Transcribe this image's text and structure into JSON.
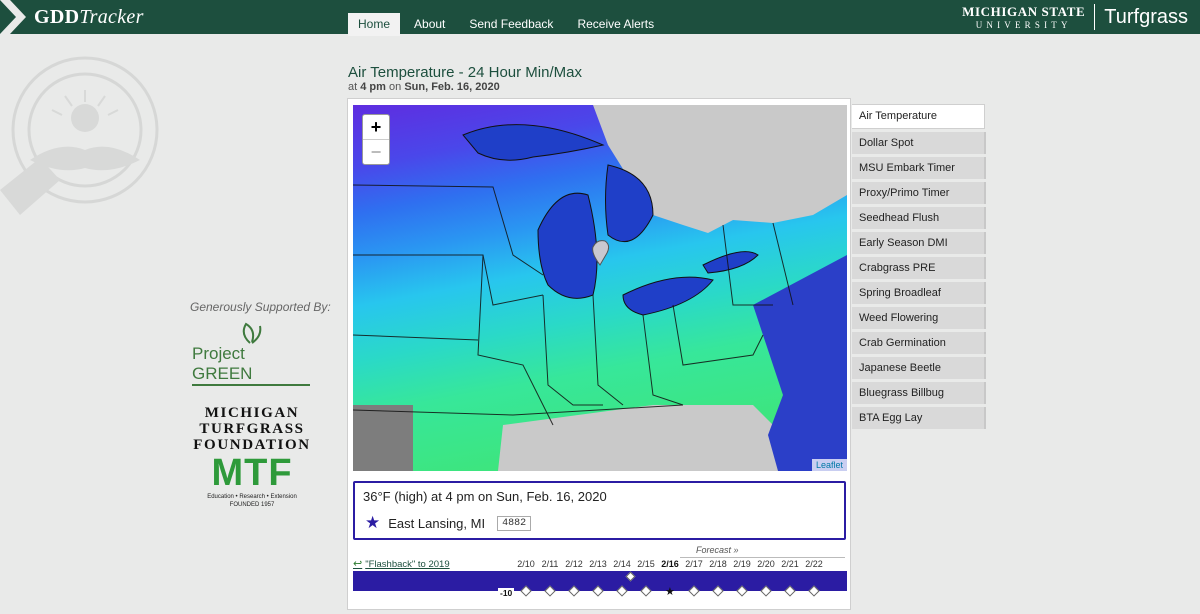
{
  "header": {
    "brand_bold": "GDD",
    "brand_italic": "Tracker",
    "nav": [
      {
        "label": "Home",
        "active": true
      },
      {
        "label": "About",
        "active": false
      },
      {
        "label": "Send Feedback",
        "active": false
      },
      {
        "label": "Receive Alerts",
        "active": false
      }
    ],
    "msu_line1": "MICHIGAN STATE",
    "msu_line2": "UNIVERSITY",
    "turfgrass": "Turfgrass"
  },
  "sidebar": {
    "supported_label": "Generously Supported By:",
    "sponsor1": "Project GREEN",
    "sponsor2": {
      "line1": "MICHIGAN",
      "line2": "TURFGRASS",
      "line3": "FOUNDATION",
      "abbr": "MTF",
      "tagline": "Education • Research • Extension",
      "founded": "FOUNDED 1957"
    }
  },
  "main": {
    "title": "Air Temperature - 24 Hour Min/Max",
    "subtitle_prefix": "at",
    "subtitle_time": "4 pm",
    "subtitle_on": "on",
    "subtitle_date": "Sun, Feb. 16, 2020",
    "zoom_in": "+",
    "zoom_out": "−",
    "attribution": "Leaflet",
    "info": {
      "reading": "36°F (high) at 4 pm on Sun, Feb. 16, 2020",
      "location": "East Lansing, MI",
      "code": "4882"
    },
    "timeline": {
      "flashback": "\"Flashback\" to 2019",
      "forecast": "Forecast »",
      "dates": [
        "2/10",
        "2/11",
        "2/12",
        "2/13",
        "2/14",
        "2/15",
        "2/16",
        "2/17",
        "2/18",
        "2/19",
        "2/20",
        "2/21",
        "2/22"
      ],
      "current": "2/16",
      "value_label": "-10"
    }
  },
  "menu": [
    {
      "label": "Air Temperature",
      "active": true
    },
    {
      "label": "Dollar Spot",
      "active": false
    },
    {
      "label": "MSU Embark Timer",
      "active": false
    },
    {
      "label": "Proxy/Primo Timer",
      "active": false
    },
    {
      "label": "Seedhead Flush",
      "active": false
    },
    {
      "label": "Early Season DMI",
      "active": false
    },
    {
      "label": "Crabgrass PRE",
      "active": false
    },
    {
      "label": "Spring Broadleaf",
      "active": false
    },
    {
      "label": "Weed Flowering",
      "active": false
    },
    {
      "label": "Crab Germination",
      "active": false
    },
    {
      "label": "Japanese Beetle",
      "active": false
    },
    {
      "label": "Bluegrass Billbug",
      "active": false
    },
    {
      "label": "BTA Egg Lay",
      "active": false
    }
  ],
  "colors": {
    "header_green": "#1d4f3e",
    "timeline_blue": "#2b1ca3",
    "map_cold": "#5b2fe0",
    "map_mid": "#2a8af0",
    "map_warm": "#34e48a",
    "lake": "#1f3fc8",
    "no_data": "#c9c9c9"
  }
}
